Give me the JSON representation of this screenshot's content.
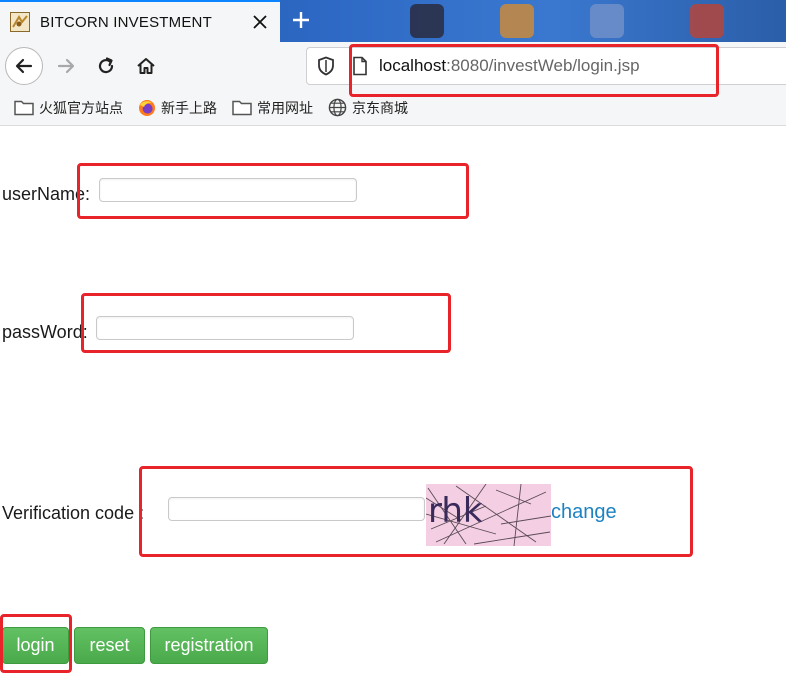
{
  "browser": {
    "tab": {
      "title": "BITCORN INVESTMENT"
    },
    "url": {
      "host": "localhost",
      "rest": ":8080/investWeb/login.jsp"
    },
    "bookmarks": [
      {
        "label": "火狐官方站点",
        "icon": "folder-icon"
      },
      {
        "label": "新手上路",
        "icon": "firefox-icon"
      },
      {
        "label": "常用网址",
        "icon": "folder-icon"
      },
      {
        "label": "京东商城",
        "icon": "globe-icon"
      }
    ]
  },
  "form": {
    "username_label": "userName:",
    "username_value": "",
    "password_label": "passWord:",
    "password_value": "",
    "verification_label": "Verification code :",
    "verification_value": "",
    "captcha_text": "rhk",
    "change_label": "change"
  },
  "buttons": {
    "login": "login",
    "reset": "reset",
    "registration": "registration"
  },
  "colors": {
    "annotation": "#e8232a",
    "button_green": "#4cae4c",
    "link": "#1c82c2",
    "captcha_bg": "#f4cfe4"
  }
}
